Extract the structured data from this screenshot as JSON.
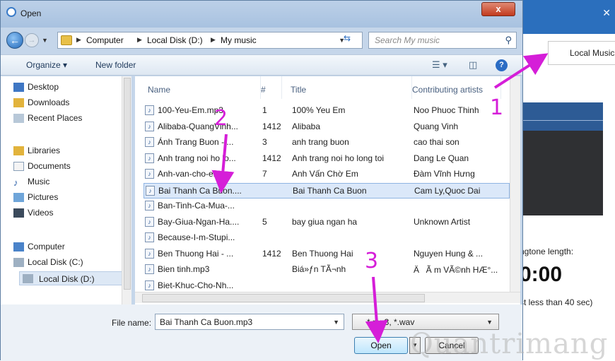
{
  "dialog": {
    "title": "Open",
    "close_label": "x"
  },
  "nav": {
    "breadcrumbs": [
      "Computer",
      "Local Disk (D:)",
      "My music"
    ],
    "search_placeholder": "Search My music"
  },
  "toolbar": {
    "organize_label": "Organize ▾",
    "new_folder_label": "New folder"
  },
  "sidebar": {
    "items": [
      {
        "label": "Desktop",
        "icon": "desktop-icon"
      },
      {
        "label": "Downloads",
        "icon": "downloads-icon"
      },
      {
        "label": "Recent Places",
        "icon": "recent-places-icon"
      },
      {
        "label": "Libraries",
        "icon": "libraries-icon"
      },
      {
        "label": "Documents",
        "icon": "documents-icon"
      },
      {
        "label": "Music",
        "icon": "music-icon"
      },
      {
        "label": "Pictures",
        "icon": "pictures-icon"
      },
      {
        "label": "Videos",
        "icon": "videos-icon"
      },
      {
        "label": "Computer",
        "icon": "computer-icon"
      },
      {
        "label": "Local Disk (C:)",
        "icon": "drive-icon"
      },
      {
        "label": "Local Disk (D:)",
        "icon": "drive-icon"
      }
    ]
  },
  "table": {
    "columns": [
      "Name",
      "#",
      "Title",
      "Contributing artists"
    ],
    "rows": [
      {
        "name": "100-Yeu-Em.mp3",
        "num": "1",
        "title": "100% Yeu Em",
        "artist": "Noo Phuoc Thinh"
      },
      {
        "name": "Alibaba-QuangVinh...",
        "num": "1412",
        "title": "Alibaba",
        "artist": "Quang Vinh"
      },
      {
        "name": "Ánh Trang Buon -....",
        "num": "3",
        "title": "anh trang buon",
        "artist": "cao thai son"
      },
      {
        "name": "Anh trang noi ho lo...",
        "num": "1412",
        "title": "Anh trang noi ho long toi",
        "artist": "Dang Le Quan"
      },
      {
        "name": "Anh-van-cho-em....",
        "num": "7",
        "title": "Anh Vấn Chờ Em",
        "artist": "Đàm Vĩnh Hưng"
      },
      {
        "name": "Bai Thanh Ca Buon....",
        "num": "",
        "title": "Bai Thanh Ca Buon",
        "artist": "Cam Ly,Quoc Dai"
      },
      {
        "name": "Ban-Tinh-Ca-Mua-...",
        "num": "",
        "title": "",
        "artist": ""
      },
      {
        "name": "Bay-Giua-Ngan-Ha....",
        "num": "5",
        "title": "bay giua ngan ha",
        "artist": "Unknown Artist"
      },
      {
        "name": "Because-I-m-Stupi...",
        "num": "",
        "title": "",
        "artist": ""
      },
      {
        "name": "Ben Thuong Hai - ...",
        "num": "1412",
        "title": "Ben Thuong Hai",
        "artist": "Nguyen Hung & ..."
      },
      {
        "name": "Bien tinh.mp3",
        "num": "",
        "title": "Biá»ƒn TÃ¬nh",
        "artist": "ÄÃ m VÃ©nh HÆ°..."
      },
      {
        "name": "Biet-Khuc-Cho-Nh...",
        "num": "",
        "title": "",
        "artist": ""
      }
    ],
    "selected_index": 5
  },
  "bottom": {
    "filename_label": "File name:",
    "filename_value": "Bai Thanh Ca Buon.mp3",
    "filetype_value": "*.mp3, *.wav",
    "open_label": "Open",
    "cancel_label": "Cancel"
  },
  "background_app": {
    "tab_label": "Local Music",
    "ringtone_label": "ngtone length:",
    "time_value": "0:00",
    "limit_text": "st less than 40 sec)"
  },
  "annotations": [
    "1",
    "2",
    "3"
  ],
  "watermark": "Quantrimang",
  "colors": {
    "accent": "#d51ed8",
    "selection": "#dbe8f9",
    "titlebar": "#bcd0e8"
  }
}
